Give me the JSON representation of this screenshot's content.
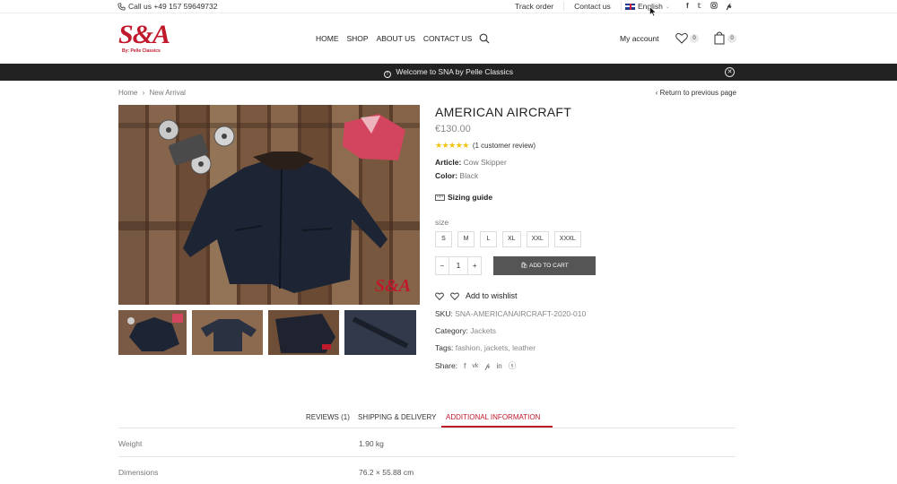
{
  "topbar": {
    "phone": "Call us +49 157 59649732",
    "track_order": "Track order",
    "contact_us": "Contact us",
    "language": "English"
  },
  "header": {
    "logo_text": "S&A",
    "logo_sub": "By: Pelle Classics",
    "nav": [
      "HOME",
      "SHOP",
      "ABOUT US",
      "CONTACT US"
    ],
    "my_account": "My account",
    "wishlist_count": "0",
    "cart_count": "0"
  },
  "promo": {
    "text": "Welcome to SNA by Pelle Classics"
  },
  "breadcrumb": {
    "home": "Home",
    "category": "New Arrival",
    "back": "Return to previous page"
  },
  "product": {
    "title": "AMERICAN AIRCRAFT",
    "price": "€130.00",
    "stars": "★★★★★",
    "review_text": "(1 customer review)",
    "article_label": "Article:",
    "article_value": "Cow Skipper",
    "color_label": "Color:",
    "color_value": "Black",
    "sizing_guide": "Sizing guide",
    "size_label": "size",
    "sizes": [
      "S",
      "M",
      "L",
      "XL",
      "XXL",
      "XXXL"
    ],
    "quantity": "1",
    "add_to_cart": "ADD TO CART",
    "add_to_wishlist": "Add to wishlist",
    "sku_label": "SKU:",
    "sku_value": "SNA-AMERICANAIRCRAFT-2020-010",
    "category_label": "Category:",
    "category_value": "Jackets",
    "tags_label": "Tags:",
    "tags": [
      "fashion",
      "jackets",
      "leather"
    ],
    "share_label": "Share:",
    "watermark": "S&A"
  },
  "tabs": {
    "items": [
      "REVIEWS (1)",
      "SHIPPING & DELIVERY",
      "ADDITIONAL INFORMATION"
    ],
    "active": "ADDITIONAL INFORMATION"
  },
  "additional_info": [
    {
      "key": "Weight",
      "value": "1.90 kg"
    },
    {
      "key": "Dimensions",
      "value": "76.2 × 55.88 cm"
    }
  ],
  "colors": {
    "brand": "#c0192c",
    "promo_bg": "#222222",
    "star": "#f4c20d"
  }
}
